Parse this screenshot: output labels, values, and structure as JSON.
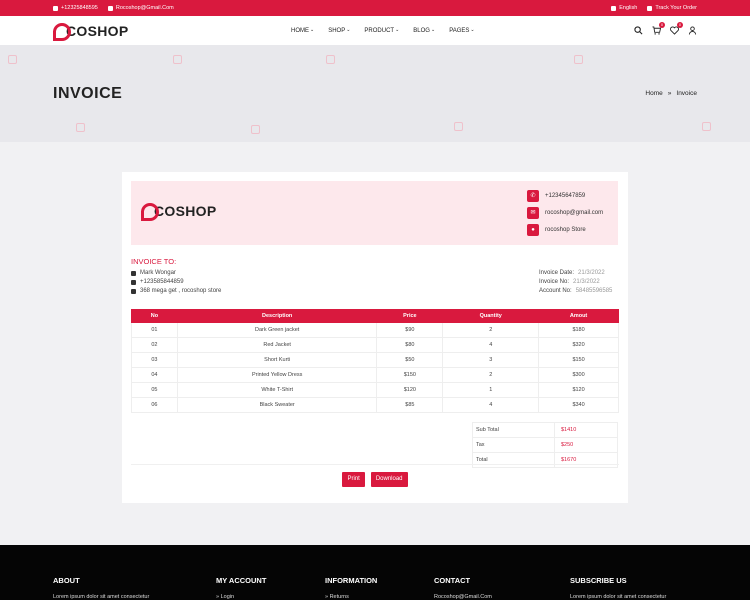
{
  "topbar": {
    "phone": "+12325848595",
    "email": "Rocoshop@Gmail.Com",
    "language": "English",
    "track": "Track Your Order"
  },
  "brand": {
    "name": "COSHOP",
    "accent": "#d9193e"
  },
  "nav": {
    "items": [
      "HOME",
      "SHOP",
      "PRODUCT",
      "BLOG",
      "PAGES"
    ],
    "icons": [
      "search-icon",
      "cart-icon",
      "heart-icon",
      "user-icon"
    ],
    "cart_count": "0",
    "wishlist_count": "0"
  },
  "banner": {
    "title": "INVOICE",
    "breadcrumb": [
      "Home",
      "»",
      "Invoice"
    ]
  },
  "invoice": {
    "contacts": [
      {
        "icon": "phone-icon",
        "text": "+12345647859"
      },
      {
        "icon": "mail-icon",
        "text": "rocoshop@gmail.com"
      },
      {
        "icon": "location-icon",
        "text": "rocoshop Store"
      }
    ],
    "to_title": "INVOICE TO:",
    "to": [
      {
        "icon": "user-icon",
        "text": "Mark Wongar"
      },
      {
        "icon": "phone-icon",
        "text": "+123585844859"
      },
      {
        "icon": "mail-icon",
        "text": "368 mega get , rocoshop store"
      }
    ],
    "meta": [
      {
        "label": "Invoice Date:",
        "value": "21/3/2022"
      },
      {
        "label": "Invoice No:",
        "value": "21/3/2022"
      },
      {
        "label": "Account No:",
        "value": "58485596585"
      }
    ],
    "columns": [
      "No",
      "Description",
      "Price",
      "Quantity",
      "Amout"
    ],
    "rows": [
      [
        "01",
        "Dark Green jacket",
        "$90",
        "2",
        "$180"
      ],
      [
        "02",
        "Red Jacket",
        "$80",
        "4",
        "$320"
      ],
      [
        "03",
        "Short Kurti",
        "$50",
        "3",
        "$150"
      ],
      [
        "04",
        "Printed Yellow Dress",
        "$150",
        "2",
        "$300"
      ],
      [
        "05",
        "White T-Shirt",
        "$120",
        "1",
        "$120"
      ],
      [
        "06",
        "Black Sweater",
        "$85",
        "4",
        "$340"
      ]
    ],
    "totals": [
      {
        "label": "Sub Total",
        "value": "$1410"
      },
      {
        "label": "Tax",
        "value": "$250"
      },
      {
        "label": "Total",
        "value": "$1670"
      }
    ],
    "print_label": "Print",
    "download_label": "Download"
  },
  "footer": {
    "headings": [
      "ABOUT",
      "MY ACCOUNT",
      "INFORMATION",
      "CONTACT",
      "SUBSCRIBE US"
    ],
    "about_text": "Lorem ipsum dolor sit amet consectetur",
    "account_first": "» Login",
    "info_first": "» Returns",
    "contact_first": "Rocoshop@Gmail.Com",
    "subscribe_text": "Lorem ipsum dolor sit amet consectetur"
  }
}
